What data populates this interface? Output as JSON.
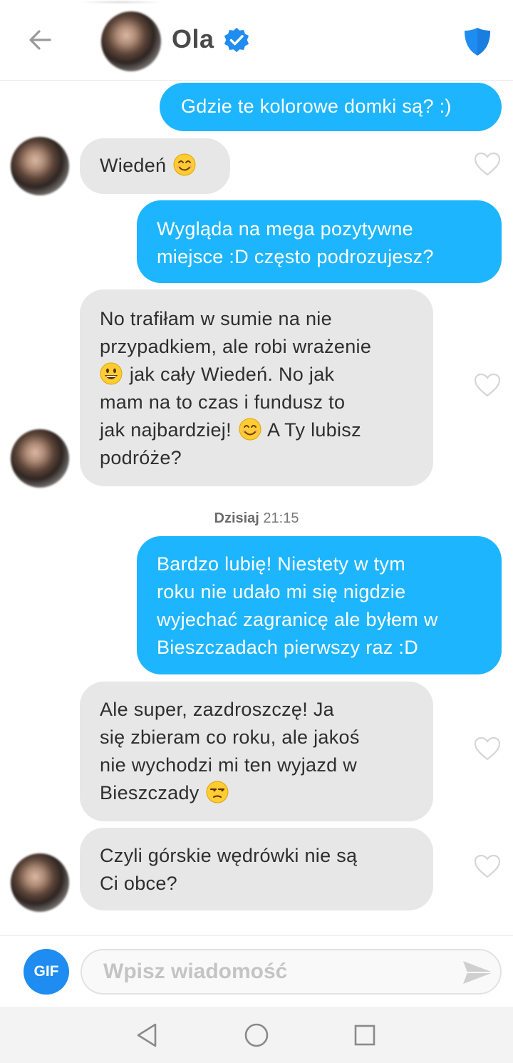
{
  "header": {
    "contact_name": "Ola",
    "verified": true,
    "icons": {
      "back": "arrow-left-icon",
      "verified": "verified-badge-icon",
      "safety": "shield-icon"
    },
    "accent_color": "#1e8cf0"
  },
  "messages": [
    {
      "direction": "out",
      "lines": [
        "Gdzie te kolorowe domki są? :)"
      ]
    },
    {
      "direction": "in",
      "lines": [
        "Wiedeń"
      ],
      "emoji_after": "smiling-face-emoji"
    },
    {
      "direction": "out",
      "lines": [
        "Wygląda na mega pozytywne",
        "miejsce :D często podrozujesz?"
      ]
    },
    {
      "direction": "in",
      "lines": [
        "No trafiłam w sumie na nie",
        "przypadkiem, ale robi wrażenie",
        "jak cały Wiedeń. No jak",
        "mam na to czas i fundusz to",
        "jak najbardziej!",
        "A Ty lubisz",
        "podróże?"
      ]
    },
    {
      "direction": "out",
      "lines": [
        "Bardzo lubię! Niestety w tym",
        "roku nie udało mi się nigdzie",
        "wyjechać zagranicę ale byłem w",
        "Bieszczadach pierwszy raz :D"
      ]
    },
    {
      "direction": "in",
      "lines": [
        "Ale super, zazdroszczę! Ja",
        "się zbieram co roku, ale jakoś",
        "nie wychodzi mi ten wyjazd w",
        "Bieszczady"
      ]
    },
    {
      "direction": "in",
      "lines": [
        "Czyli górskie wędrówki nie są",
        "Ci obce?"
      ]
    }
  ],
  "timestamp": {
    "day": "Dzisiaj",
    "time": "21:15"
  },
  "composer": {
    "gif_label": "GIF",
    "placeholder": "Wpisz wiadomość",
    "icons": {
      "send": "send-icon"
    }
  },
  "navigation": {
    "icons": [
      "back-triangle-icon",
      "home-circle-icon",
      "recents-square-icon"
    ]
  },
  "colors": {
    "outgoing_bubble": "#1eb5ff",
    "incoming_bubble": "#e7e7e7"
  }
}
